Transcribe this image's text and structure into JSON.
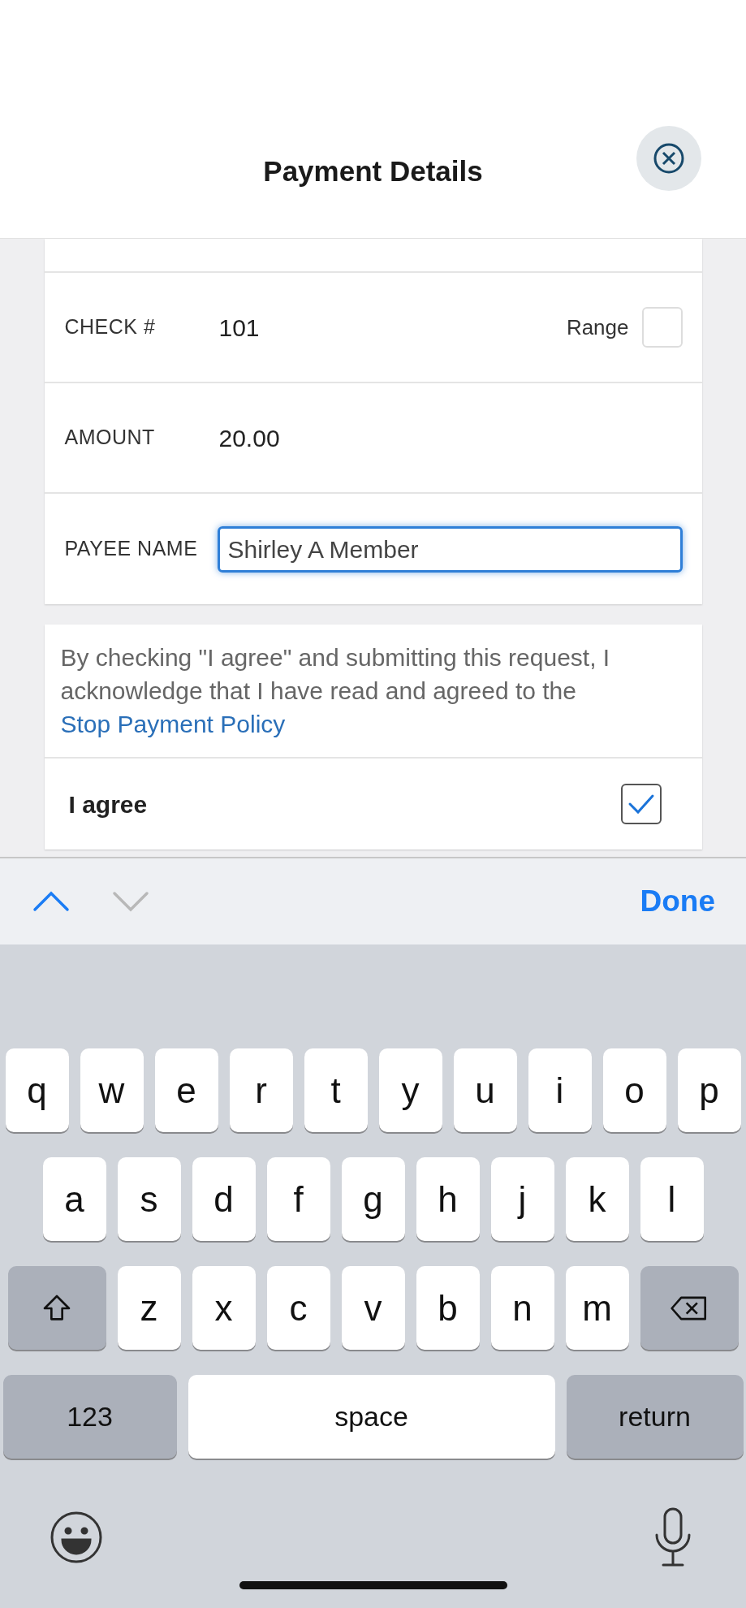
{
  "header": {
    "title": "Payment Details"
  },
  "form": {
    "rows": [
      {
        "kind": "text",
        "label": "CHECK #",
        "value": "101",
        "option": {
          "label": "Range",
          "checked": false
        }
      },
      {
        "kind": "text",
        "label": "AMOUNT",
        "value": "20.00"
      },
      {
        "kind": "input",
        "label": "PAYEE NAME",
        "value": "Shirley A Member",
        "focused": true
      }
    ]
  },
  "consent": {
    "text": "By checking \"I agree\" and submitting this request, I acknowledge that I have read and agreed to the",
    "link": "Stop Payment Policy",
    "agree_label": "I agree",
    "checked": true
  },
  "toolbar": {
    "previous_enabled": true,
    "next_enabled": false,
    "done": "Done"
  },
  "keyboard": {
    "rows": [
      {
        "keys": [
          {
            "kind": "letter",
            "label": "q"
          },
          {
            "kind": "letter",
            "label": "w"
          },
          {
            "kind": "letter",
            "label": "e"
          },
          {
            "kind": "letter",
            "label": "r"
          },
          {
            "kind": "letter",
            "label": "t"
          },
          {
            "kind": "letter",
            "label": "y"
          },
          {
            "kind": "letter",
            "label": "u"
          },
          {
            "kind": "letter",
            "label": "i"
          },
          {
            "kind": "letter",
            "label": "o"
          },
          {
            "kind": "letter",
            "label": "p"
          }
        ]
      },
      {
        "keys": [
          {
            "kind": "letter",
            "label": "a"
          },
          {
            "kind": "letter",
            "label": "s"
          },
          {
            "kind": "letter",
            "label": "d"
          },
          {
            "kind": "letter",
            "label": "f"
          },
          {
            "kind": "letter",
            "label": "g"
          },
          {
            "kind": "letter",
            "label": "h"
          },
          {
            "kind": "letter",
            "label": "j"
          },
          {
            "kind": "letter",
            "label": "k"
          },
          {
            "kind": "letter",
            "label": "l"
          }
        ]
      },
      {
        "keys": [
          {
            "kind": "shift"
          },
          {
            "kind": "letter",
            "label": "z"
          },
          {
            "kind": "letter",
            "label": "x"
          },
          {
            "kind": "letter",
            "label": "c"
          },
          {
            "kind": "letter",
            "label": "v"
          },
          {
            "kind": "letter",
            "label": "b"
          },
          {
            "kind": "letter",
            "label": "n"
          },
          {
            "kind": "letter",
            "label": "m"
          },
          {
            "kind": "delete"
          }
        ]
      },
      {
        "keys": [
          {
            "kind": "numbers",
            "label": "123"
          },
          {
            "kind": "space",
            "label": "space"
          },
          {
            "kind": "return",
            "label": "return"
          }
        ]
      }
    ]
  }
}
